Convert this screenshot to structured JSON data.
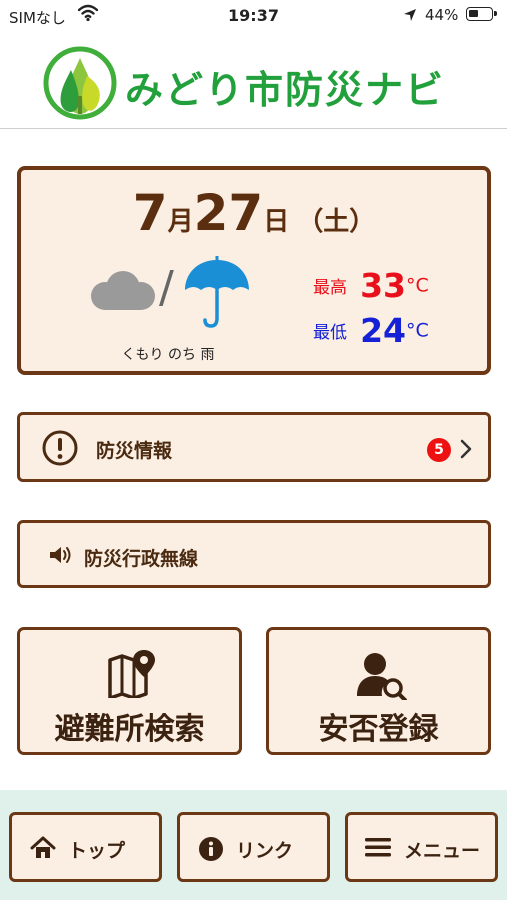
{
  "status_bar": {
    "carrier": "SIMなし",
    "time": "19:37",
    "battery": "44%",
    "battery_level": 0.44
  },
  "header": {
    "app_title": "みどり市防災ナビ",
    "brand_color": "#22a03c"
  },
  "weather": {
    "month": "7",
    "month_unit": "月",
    "day": "27",
    "day_unit": "日",
    "weekday": "（土）",
    "description": "くもり のち 雨",
    "icons": [
      "cloud-icon",
      "umbrella-icon"
    ],
    "high_label": "最高",
    "high_value": "33",
    "high_unit": "°C",
    "low_label": "最低",
    "low_value": "24",
    "low_unit": "°C",
    "high_color": "#e8101a",
    "low_color": "#1421d6"
  },
  "menu": {
    "disaster_info_label": "防災情報",
    "disaster_info_badge": "5",
    "radio_label": "防災行政無線"
  },
  "tiles": {
    "shelter_search_label": "避難所検索",
    "safety_register_label": "安否登録"
  },
  "bottom_nav": {
    "top_label": "トップ",
    "link_label": "リンク",
    "menu_label": "メニュー"
  },
  "colors": {
    "border": "#6b3714",
    "card_bg": "#fbeee2",
    "nav_bg": "#dff1ea"
  }
}
